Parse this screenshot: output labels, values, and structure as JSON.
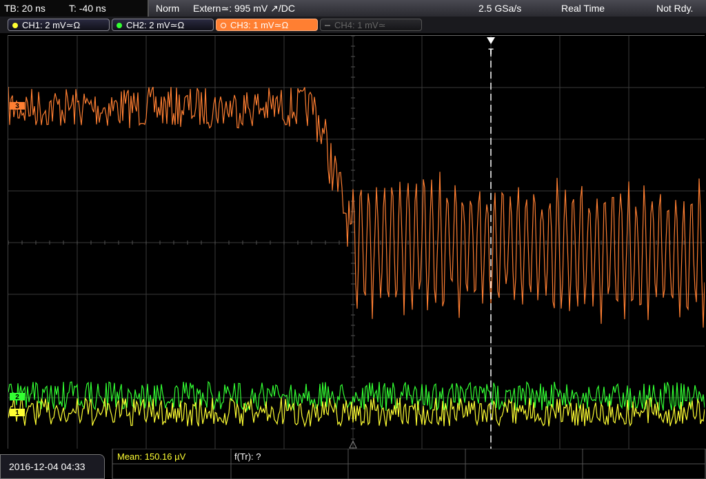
{
  "topbar": {
    "timebase": "TB: 20 ns",
    "trigger_time": "T: -40 ns",
    "trigger_mode": "Norm",
    "trigger_source": "Extern≃: 995 mV ↗/DC",
    "sample_rate": "2.5 GSa/s",
    "acq_mode": "Real Time",
    "status": "Not Rdy."
  },
  "channels": [
    {
      "label": "CH1: 2 mV≃Ω",
      "color": "#ffff33",
      "state": "on"
    },
    {
      "label": "CH2: 2 mV≃Ω",
      "color": "#33ff33",
      "state": "on"
    },
    {
      "label": "CH3: 1 mV≃Ω",
      "color": "#ff7f32",
      "state": "active"
    },
    {
      "label": "CH4: 1 mV≃",
      "color": "#777777",
      "state": "off"
    }
  ],
  "markers": {
    "ch3": "3",
    "ch2": "2",
    "ch1": "1",
    "trigger": "T"
  },
  "bottombar": {
    "datetime": "2016-12-04 04:33",
    "mean": "Mean: 150.16 µV",
    "rise_time": "f(Tr): ?"
  },
  "colors": {
    "ch1": "#ffff33",
    "ch2": "#33ff33",
    "ch3": "#ff7f32",
    "grid": "#3a3a3a"
  }
}
